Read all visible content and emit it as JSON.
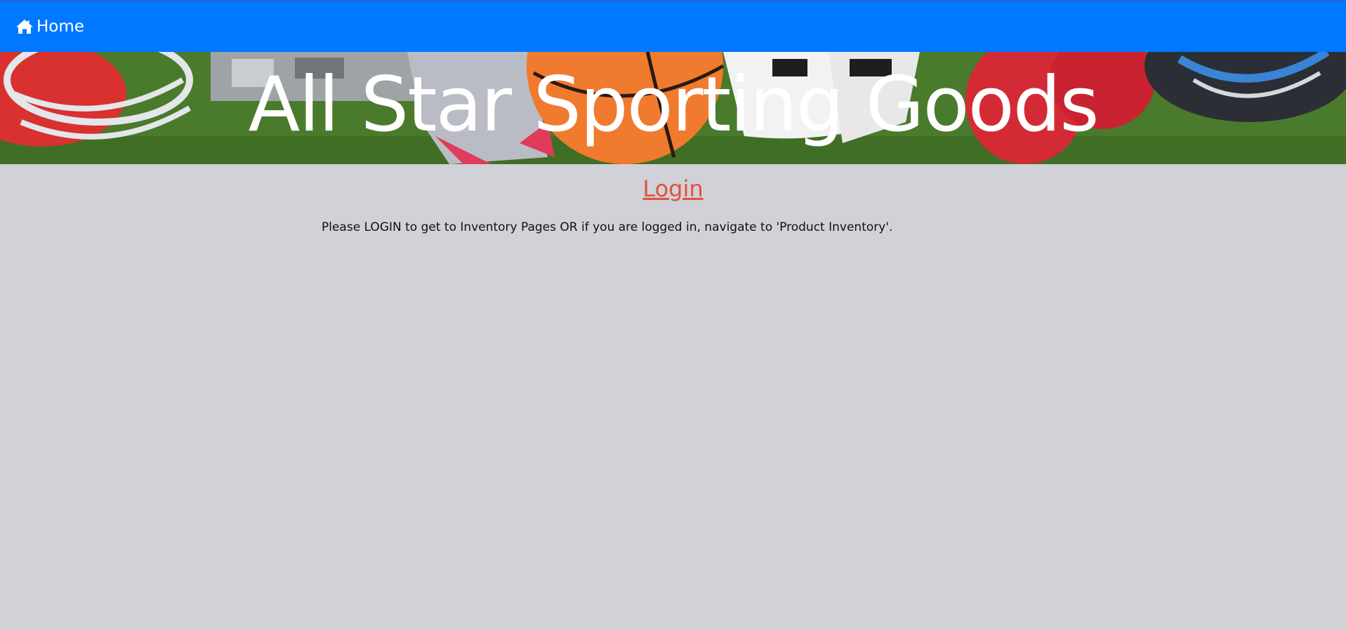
{
  "navbar": {
    "home_icon": "home-icon",
    "home_label": "Home",
    "color": "#0078ff"
  },
  "banner": {
    "title": "All Star Sporting Goods"
  },
  "main": {
    "login_link": "Login",
    "login_color": "#e1513f",
    "message": "Please LOGIN to get to Inventory Pages OR if you are logged in, navigate to 'Product Inventory'."
  }
}
